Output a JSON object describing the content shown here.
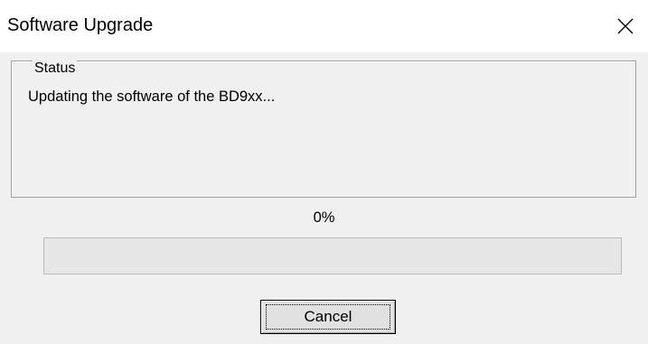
{
  "window": {
    "title": "Software Upgrade",
    "close_icon": "close-icon"
  },
  "status_group": {
    "label": "Status",
    "message": "Updating the software of the BD9xx..."
  },
  "progress": {
    "percent_text": "0%",
    "value": 0,
    "fill_color": "#06b025"
  },
  "buttons": {
    "cancel_label": "Cancel"
  }
}
